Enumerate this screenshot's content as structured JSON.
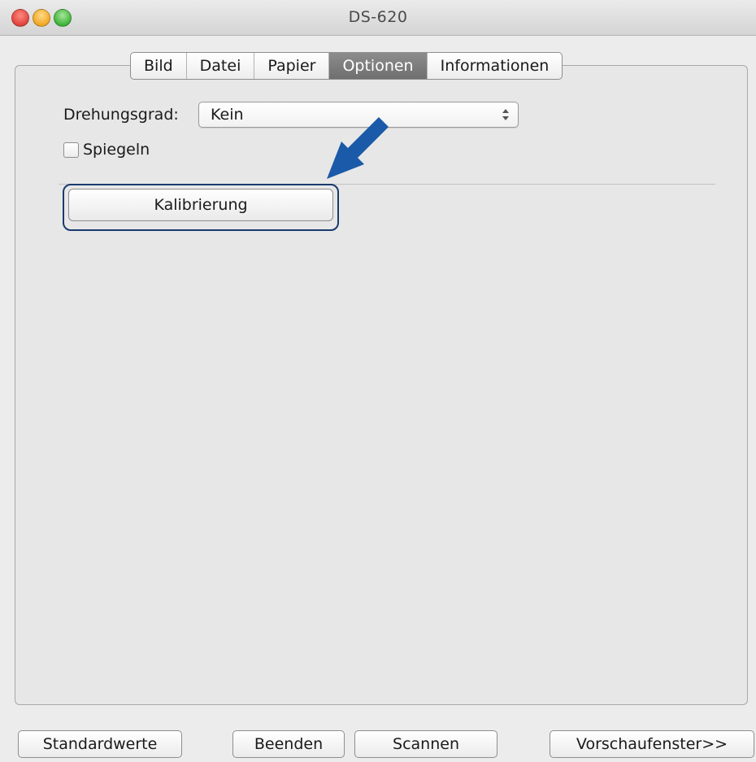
{
  "window": {
    "title": "DS-620"
  },
  "tabs": [
    {
      "label": "Bild",
      "active": false
    },
    {
      "label": "Datei",
      "active": false
    },
    {
      "label": "Papier",
      "active": false
    },
    {
      "label": "Optionen",
      "active": true
    },
    {
      "label": "Informationen",
      "active": false
    }
  ],
  "options": {
    "rotation_label": "Drehungsgrad:",
    "rotation_value": "Kein",
    "mirror_label": "Spiegeln",
    "mirror_checked": false,
    "calibration_button": "Kalibrierung"
  },
  "annotation": {
    "arrow_color": "#1a5aa8",
    "highlight_color": "#1a3a6e"
  },
  "footer": {
    "defaults_button": "Standardwerte",
    "quit_button": "Beenden",
    "scan_button": "Scannen",
    "preview_button": "Vorschaufenster>>"
  }
}
